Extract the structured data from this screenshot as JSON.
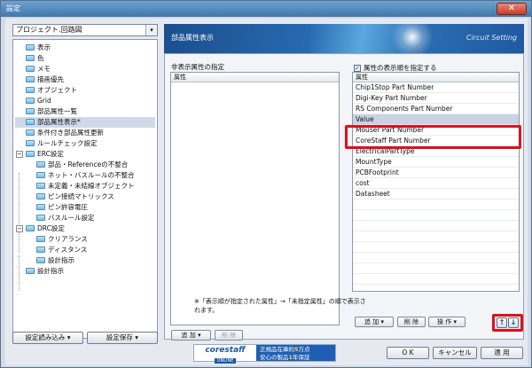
{
  "window": {
    "title": "設定",
    "close_glyph": "✕"
  },
  "project_select": {
    "value": "プロジェクト.回路図",
    "arrow": "▾"
  },
  "tree": [
    {
      "label": "表示"
    },
    {
      "label": "色"
    },
    {
      "label": "メモ"
    },
    {
      "label": "描画優先"
    },
    {
      "label": "オブジェクト"
    },
    {
      "label": "Grid"
    },
    {
      "label": "部品属性一覧"
    },
    {
      "label": "部品属性表示*"
    },
    {
      "label": "条件付き部品属性更新"
    },
    {
      "label": "ルールチェック設定"
    },
    {
      "label": "ERC設定"
    },
    {
      "label": "部品・Referenceの不整合"
    },
    {
      "label": "ネット・バスルールの不整合"
    },
    {
      "label": "未定義・未結線オブジェクト"
    },
    {
      "label": "ピン接続マトリックス"
    },
    {
      "label": "ピン許容電圧"
    },
    {
      "label": "バスルール設定"
    },
    {
      "label": "DRC設定"
    },
    {
      "label": "クリアランス"
    },
    {
      "label": "ディスタンス"
    },
    {
      "label": "設計指示"
    },
    {
      "label": "設計指示"
    }
  ],
  "tree_expanders": {
    "minus": "−"
  },
  "left_buttons": {
    "load": "設定読み込み ▾",
    "save": "設定保存 ▾"
  },
  "banner": {
    "title": "部品属性表示",
    "subtitle": "Circuit Setting"
  },
  "hidden_list": {
    "title": "非表示属性の指定",
    "header": "属性"
  },
  "hidden_buttons": {
    "add": "追 加 ▾",
    "delete": "削 除"
  },
  "display_order": {
    "checkbox_label": "属性の表示順を指定する",
    "checkbox_mark": "✓",
    "header": "属性",
    "rows": [
      "Chip1Stop Part Number",
      "Digi-Key Part Number",
      "RS Components Part Number",
      "Value",
      "Mouser Part Number",
      "CoreStaff Part Number",
      "ElectricalPartType",
      "MountType",
      "PCBFootprint",
      "cost",
      "Datasheet"
    ]
  },
  "display_buttons": {
    "add": "追 加 ▾",
    "delete": "削 除",
    "operate": "操 作 ▾",
    "up": "↑",
    "down": "↓"
  },
  "note": "※「表示順が指定された属性」→「未指定属性」の順で表示されます。",
  "ad": {
    "logo": "corestaff",
    "online": "ONLINE",
    "line1_a": "正規品在庫約",
    "line1_b": "5",
    "line1_c": "万点",
    "line2_a": "安心の製品",
    "line2_b": "1",
    "line2_c": "年保証"
  },
  "footer": {
    "ok": "O K",
    "cancel": "キャンセル",
    "apply": "適 用"
  }
}
